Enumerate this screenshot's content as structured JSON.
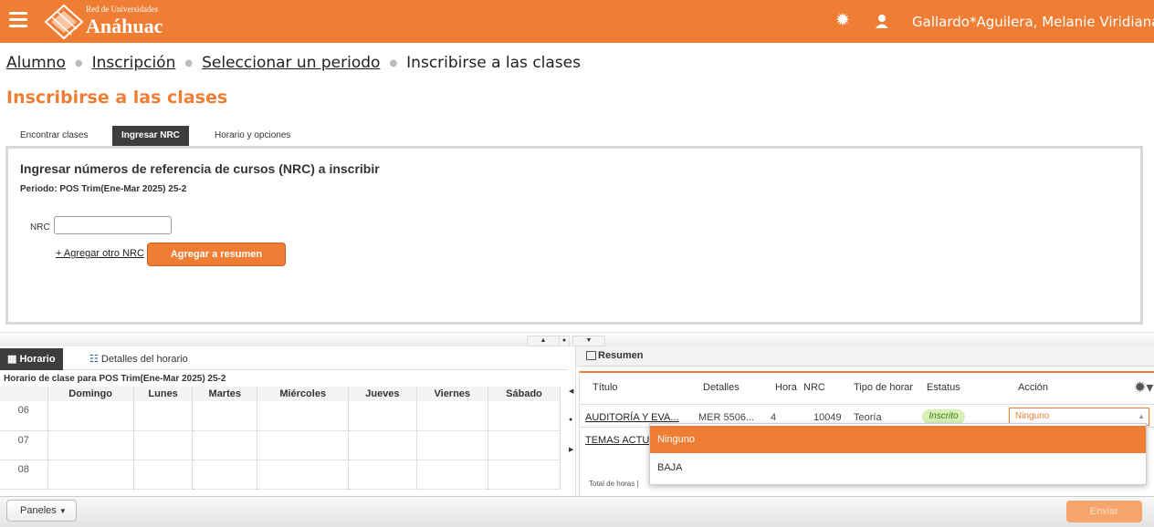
{
  "header": {
    "logo_small": "Red de Universidades",
    "logo_big": "Anáhuac",
    "username": "Gallardo*Aguilera, Melanie Viridiana",
    "brand_color": "#f07d34"
  },
  "breadcrumb": {
    "items": [
      "Alumno",
      "Inscripción",
      "Seleccionar un periodo"
    ],
    "current": "Inscribirse a las clases"
  },
  "page_title": "Inscribirse a las clases",
  "tabs": [
    "Encontrar clases",
    "Ingresar NRC",
    "Horario y opciones"
  ],
  "active_tab": "Ingresar NRC",
  "nrc_panel": {
    "heading": "Ingresar números de referencia de cursos (NRC) a inscribir",
    "periodo": "Periodo: POS Trim(Ene-Mar 2025) 25-2",
    "nrc_label": "NRC",
    "nrc_value": "",
    "add_link": "+ Agregar otro NRC",
    "add_button": "Agregar a resumen"
  },
  "schedule": {
    "tabs": [
      "Horario",
      "Detalles del horario"
    ],
    "title": "Horario de clase para POS Trim(Ene-Mar 2025) 25-2",
    "days": [
      "Domingo",
      "Lunes",
      "Martes",
      "Miércoles",
      "Jueves",
      "Viernes",
      "Sábado"
    ],
    "hours": [
      "06",
      "07",
      "08"
    ]
  },
  "summary": {
    "title": "Resumen",
    "columns": [
      "Título",
      "Detalles",
      "Hora",
      "NRC",
      "Tipo de horar",
      "Estatus",
      "Acción"
    ],
    "rows": [
      {
        "titulo": "AUDITORÍA Y EVA...",
        "detalles": "MER 5506...",
        "horas": "4",
        "nrc": "10049",
        "tipo": "Teoría",
        "estatus": "Inscrito",
        "accion": "Ninguno"
      },
      {
        "titulo": "TEMAS ACTU"
      }
    ],
    "total_label": "Total de horas |"
  },
  "dropdown": {
    "options": [
      "Ninguno",
      "BAJA"
    ],
    "selected": "Ninguno"
  },
  "footer": {
    "panels_button": "Paneles",
    "submit_button": "Enviar"
  }
}
